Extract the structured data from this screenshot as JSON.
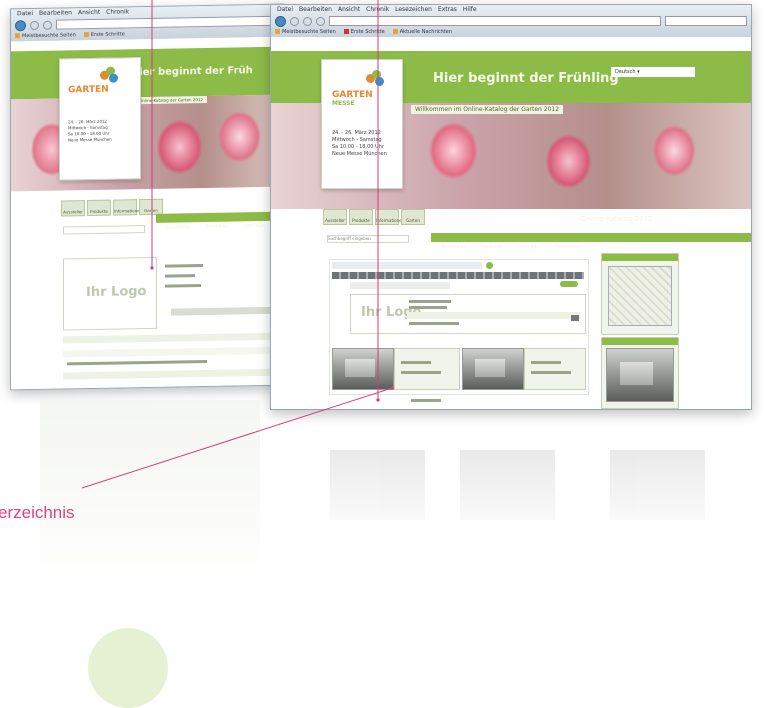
{
  "caption": {
    "text": "erzeichnis",
    "color": "#e0427d"
  },
  "browser": {
    "menu_items": [
      "Datei",
      "Bearbeiten",
      "Ansicht",
      "Chronik",
      "Lesezeichen",
      "Extras",
      "Hilfe"
    ],
    "bookmarks": [
      "Meistbesuchte Seiten",
      "Erste Schritte",
      "Aktuelle Nachrichten"
    ]
  },
  "site": {
    "slogan_front": "Hier beginnt der Frühling",
    "slogan_back": "Hier beginnt der Früh",
    "logo_text": "GARTEN",
    "logo_sub": "MESSE",
    "event_info": "24. - 26. März 2012\nMittwoch - Samstag\nSa 10.00 - 18.00 Uhr\nNeue Messe München",
    "welcome_line": "Willkommen im Online-Katalog der Garten 2012",
    "ihr_logo": "Ihr Logo",
    "location_label": "Online-Katalog 2012",
    "tab_labels": [
      "Aussteller",
      "Produkte",
      "Informationen",
      "Garten"
    ],
    "nav_items": [
      "Aussteller",
      "Produkte",
      "Vorträge",
      "Hallenplan"
    ],
    "search_placeholder": "Suchbegriff eingeben",
    "lang": "Deutsch"
  },
  "colors": {
    "green": "#8dbb47",
    "pink_accent": "#e0427d"
  },
  "icons": {
    "nav": [
      "back-icon",
      "forward-icon",
      "reload-icon",
      "home-icon"
    ]
  }
}
